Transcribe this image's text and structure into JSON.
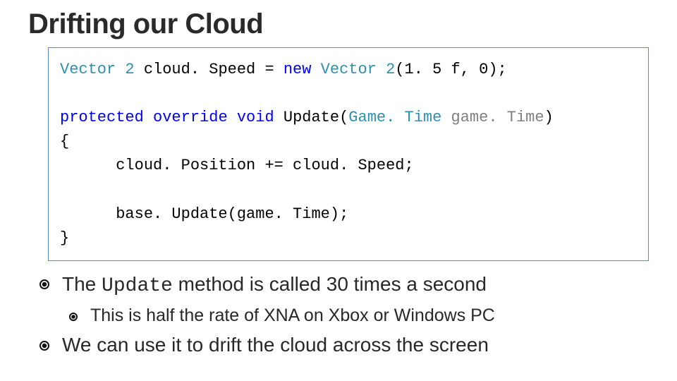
{
  "title": "Drifting our Cloud",
  "code": {
    "l1": {
      "a": "Vector 2",
      "b": " cloud. Speed = ",
      "c": "new",
      "d": " ",
      "e": "Vector 2",
      "f": "(1. 5 f, 0);"
    },
    "l2": {
      "a": "protected",
      "b": " ",
      "c": "override",
      "d": " ",
      "e": "void",
      "f": " Update(",
      "g": "Game. Time",
      "h": " ",
      "i": "game. Time",
      "j": ")"
    },
    "l3": "{",
    "l4": "      cloud. Position += cloud. Speed;",
    "l5": "      base. Update(game. Time);",
    "l6": "}"
  },
  "bullets": {
    "b1_pre": "The ",
    "b1_code": "Update",
    "b1_post": " method is called 30 times a second",
    "b1a": "This is half the rate of XNA on Xbox or Windows PC",
    "b2": "We can use it to drift the cloud across the screen"
  }
}
